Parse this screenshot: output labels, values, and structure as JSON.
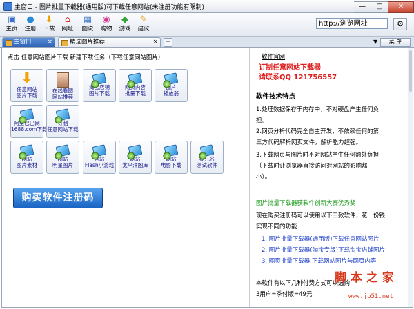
{
  "window": {
    "title": "主窗口 - 图片批量下载器(通用版)可下载任意网站(未注册功能有限制)",
    "controls": {
      "minimize": "—",
      "maximize": "□",
      "close": "✕"
    }
  },
  "toolbar": {
    "buttons": [
      {
        "label": "主页",
        "icon": "home-page-icon",
        "glyph": "▣",
        "color": "#3a6fc4"
      },
      {
        "label": "注册",
        "icon": "register-icon",
        "glyph": "●",
        "color": "#2b8ad6"
      },
      {
        "label": "下载",
        "icon": "download-icon",
        "glyph": "⬇",
        "color": "#f0a000"
      },
      {
        "label": "网址",
        "icon": "url-home-icon",
        "glyph": "⌂",
        "color": "#d7342a"
      },
      {
        "label": "图说",
        "icon": "picture-icon",
        "glyph": "▦",
        "color": "#4c7fc9"
      },
      {
        "label": "购物",
        "icon": "shopping-icon",
        "glyph": "◉",
        "color": "#d23b8e"
      },
      {
        "label": "游戏",
        "icon": "game-icon",
        "glyph": "◆",
        "color": "#36a23a"
      },
      {
        "label": "建议",
        "icon": "suggest-icon",
        "glyph": "✎",
        "color": "#e5a020"
      }
    ],
    "address": "http://浏览网址"
  },
  "tabs": [
    {
      "label": "主窗口"
    },
    {
      "label": "精选图片推荐"
    }
  ],
  "tabbar": {
    "new_tab": "+",
    "menu": "菜 单",
    "menu_arrow": "▼"
  },
  "main": {
    "header": "点击 任意网站图片下载 新建下载任务（下载任意网站图片）",
    "tiles": [
      {
        "label1": "任意网站",
        "label2": "图片下载",
        "icon": "download-arrow-icon"
      },
      {
        "label1": "在线看图",
        "label2": "网站推荐",
        "icon": "photo-icon"
      },
      {
        "label1": "淘宝店铺",
        "label2": "图片下载",
        "icon": "gem-icon"
      },
      {
        "label1": "网页内容",
        "label2": "批量下载",
        "icon": "gem-icon"
      },
      {
        "label1": "图片",
        "label2": "播放器",
        "icon": "gem-icon"
      },
      {
        "label1": "阿里巴巴网",
        "label2": "1688.com下载",
        "icon": "gem-icon"
      },
      {
        "label1": "订制",
        "label2": "任意网站下载",
        "icon": "gem-icon"
      },
      {
        "label1": "网站",
        "label2": "图片素材",
        "icon": "gem-icon"
      },
      {
        "label1": "网站",
        "label2": "明星图片",
        "icon": "gem-icon"
      },
      {
        "label1": "网站",
        "label2": "Flash小游戏",
        "icon": "gem-icon"
      },
      {
        "label1": "网站",
        "label2": "太平洋图库",
        "icon": "gem-icon"
      },
      {
        "label1": "网站",
        "label2": "电影下载",
        "icon": "gem-icon"
      },
      {
        "label1": "婴儿名",
        "label2": "测试软件",
        "icon": "gem-icon"
      }
    ],
    "buy_button": "购买软件注册码"
  },
  "right": {
    "official_site": "软件官网",
    "custom_line1": "订制任意网站下载器",
    "custom_line2": "请联系QQ  121756557",
    "features_title": "软件技术特点",
    "lines": [
      "1.处理数据保存于内存中，不对硬盘产生任何负",
      "担。",
      "2.网页分析代码完全自主开发，不依赖任何的第",
      "三方代码解析网页文件，解析能力超强。",
      "3.下载网页与图片时不对网站产生任何额外负担",
      "（下载时让浏览器直接访问对网站的影响都",
      "小）。"
    ],
    "award": "图片批量下载器获软件创新大赛优秀奖",
    "reg_intro1": "现在购买注册码可以使用以下三款软件，花一份钱",
    "reg_intro2": "实现不同的功能",
    "items": [
      "1. 图片批量下载器(通用版)下载任意网站图片",
      "2. 图片批量下载器(淘宝专版)下载淘宝店铺图片",
      "3. 网页批量下载器  下载网站图片与网页内容"
    ],
    "pay_line": "本软件有以下几种付费方式可以选购",
    "price_line": "3用户=季付版=49元"
  },
  "watermark": {
    "line1": "脚 本 之 家",
    "line2": "www.jb51.net"
  }
}
